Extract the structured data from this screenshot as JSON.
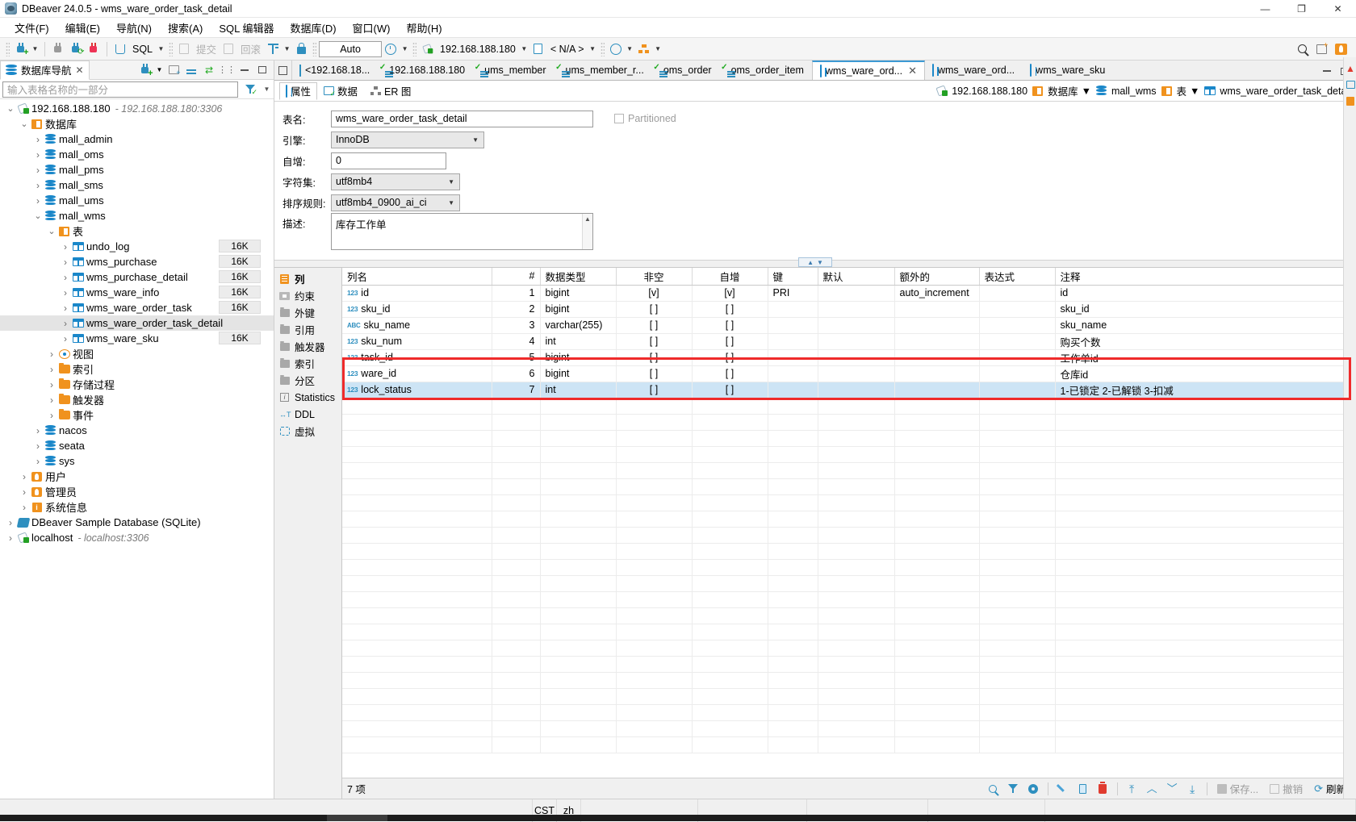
{
  "window": {
    "title": "DBeaver 24.0.5 - wms_ware_order_task_detail",
    "minimize": "—",
    "maximize": "❐",
    "close": "✕"
  },
  "menu": [
    {
      "label": "文件(F)"
    },
    {
      "label": "编辑(E)"
    },
    {
      "label": "导航(N)"
    },
    {
      "label": "搜索(A)"
    },
    {
      "label": "SQL 编辑器"
    },
    {
      "label": "数据库(D)"
    },
    {
      "label": "窗口(W)"
    },
    {
      "label": "帮助(H)"
    }
  ],
  "toolbar": {
    "sql_label": "SQL",
    "commit_label": "提交",
    "rollback_label": "回滚",
    "auto_label": "Auto",
    "connection": "192.168.188.180",
    "schema": "< N/A >"
  },
  "navigator": {
    "tab_label": "数据库导航",
    "tab_close": "✕",
    "filter_placeholder": "输入表格名称的一部分",
    "tree": [
      {
        "level": 0,
        "twisty": "v",
        "icon": "connection-icon",
        "label": "192.168.188.180",
        "sub": "- 192.168.188.180:3306"
      },
      {
        "level": 1,
        "twisty": "v",
        "icon": "databases-folder-icon",
        "label": "数据库"
      },
      {
        "level": 2,
        "twisty": ">",
        "icon": "database-icon",
        "label": "mall_admin"
      },
      {
        "level": 2,
        "twisty": ">",
        "icon": "database-icon",
        "label": "mall_oms"
      },
      {
        "level": 2,
        "twisty": ">",
        "icon": "database-icon",
        "label": "mall_pms"
      },
      {
        "level": 2,
        "twisty": ">",
        "icon": "database-icon",
        "label": "mall_sms"
      },
      {
        "level": 2,
        "twisty": ">",
        "icon": "database-icon",
        "label": "mall_ums"
      },
      {
        "level": 2,
        "twisty": "v",
        "icon": "database-icon",
        "label": "mall_wms"
      },
      {
        "level": 3,
        "twisty": "v",
        "icon": "tables-folder-icon",
        "label": "表"
      },
      {
        "level": 4,
        "twisty": ">",
        "icon": "table-icon",
        "label": "undo_log",
        "size": "16K"
      },
      {
        "level": 4,
        "twisty": ">",
        "icon": "table-icon",
        "label": "wms_purchase",
        "size": "16K"
      },
      {
        "level": 4,
        "twisty": ">",
        "icon": "table-icon",
        "label": "wms_purchase_detail",
        "size": "16K"
      },
      {
        "level": 4,
        "twisty": ">",
        "icon": "table-icon",
        "label": "wms_ware_info",
        "size": "16K"
      },
      {
        "level": 4,
        "twisty": ">",
        "icon": "table-icon",
        "label": "wms_ware_order_task",
        "size": "16K"
      },
      {
        "level": 4,
        "twisty": ">",
        "icon": "table-icon",
        "label": "wms_ware_order_task_detail",
        "size": "",
        "selected": true
      },
      {
        "level": 4,
        "twisty": ">",
        "icon": "table-icon",
        "label": "wms_ware_sku",
        "size": "16K"
      },
      {
        "level": 3,
        "twisty": ">",
        "icon": "view-icon",
        "label": "视图"
      },
      {
        "level": 3,
        "twisty": ">",
        "icon": "folder-icon",
        "label": "索引"
      },
      {
        "level": 3,
        "twisty": ">",
        "icon": "folder-icon",
        "label": "存储过程"
      },
      {
        "level": 3,
        "twisty": ">",
        "icon": "folder-icon",
        "label": "触发器"
      },
      {
        "level": 3,
        "twisty": ">",
        "icon": "folder-icon",
        "label": "事件"
      },
      {
        "level": 2,
        "twisty": ">",
        "icon": "database-icon",
        "label": "nacos"
      },
      {
        "level": 2,
        "twisty": ">",
        "icon": "database-icon",
        "label": "seata"
      },
      {
        "level": 2,
        "twisty": ">",
        "icon": "database-icon",
        "label": "sys"
      },
      {
        "level": 1,
        "twisty": ">",
        "icon": "users-icon",
        "label": "用户"
      },
      {
        "level": 1,
        "twisty": ">",
        "icon": "admin-icon",
        "label": "管理员"
      },
      {
        "level": 1,
        "twisty": ">",
        "icon": "sysinfo-icon",
        "label": "系统信息"
      },
      {
        "level": 0,
        "twisty": ">",
        "icon": "sqlite-icon",
        "label": "DBeaver Sample Database (SQLite)"
      },
      {
        "level": 0,
        "twisty": ">",
        "icon": "connection-icon",
        "label": "localhost",
        "sub": "- localhost:3306"
      }
    ]
  },
  "editor_tabs": [
    {
      "label": "<192.168.18...",
      "icon": "sql-editor-icon",
      "active": false
    },
    {
      "label": "192.168.188.180",
      "icon": "script-icon",
      "active": false
    },
    {
      "label": "ums_member",
      "icon": "script-icon",
      "active": false
    },
    {
      "label": "ums_member_r...",
      "icon": "script-icon",
      "active": false
    },
    {
      "label": "oms_order",
      "icon": "script-icon",
      "active": false
    },
    {
      "label": "oms_order_item",
      "icon": "script-icon",
      "active": false
    },
    {
      "label": "wms_ware_ord...",
      "icon": "table-icon",
      "active": true,
      "close": "✕"
    },
    {
      "label": "wms_ware_ord...",
      "icon": "table-icon",
      "active": false
    },
    {
      "label": "wms_ware_sku",
      "icon": "table-icon",
      "active": false
    }
  ],
  "property_tabs": [
    {
      "label": "属性",
      "icon": "properties-icon",
      "active": true
    },
    {
      "label": "数据",
      "icon": "data-icon",
      "active": false
    },
    {
      "label": "ER 图",
      "icon": "er-diagram-icon",
      "active": false
    }
  ],
  "breadcrumb": [
    {
      "label": "192.168.188.180",
      "icon": "connection-icon",
      "caret": false
    },
    {
      "label": "数据库",
      "icon": "databases-folder-icon",
      "caret": true
    },
    {
      "label": "mall_wms",
      "icon": "database-icon",
      "caret": false
    },
    {
      "label": "表",
      "icon": "tables-folder-icon",
      "caret": true
    },
    {
      "label": "wms_ware_order_task_detail",
      "icon": "table-icon",
      "caret": false
    }
  ],
  "form": {
    "table_name_label": "表名:",
    "table_name_value": "wms_ware_order_task_detail",
    "partitioned_label": "Partitioned",
    "engine_label": "引擎:",
    "engine_value": "InnoDB",
    "auto_increment_label": "自增:",
    "auto_increment_value": "0",
    "charset_label": "字符集:",
    "charset_value": "utf8mb4",
    "collation_label": "排序规则:",
    "collation_value": "utf8mb4_0900_ai_ci",
    "description_label": "描述:",
    "description_value": "库存工作单"
  },
  "side_tabs": [
    {
      "label": "列",
      "icon": "columns-icon",
      "active": true
    },
    {
      "label": "约束",
      "icon": "constraints-icon",
      "active": false
    },
    {
      "label": "外键",
      "icon": "foreign-keys-icon",
      "active": false
    },
    {
      "label": "引用",
      "icon": "references-icon",
      "active": false
    },
    {
      "label": "触发器",
      "icon": "triggers-icon",
      "active": false
    },
    {
      "label": "索引",
      "icon": "indexes-icon",
      "active": false
    },
    {
      "label": "分区",
      "icon": "partitions-icon",
      "active": false
    },
    {
      "label": "Statistics",
      "icon": "statistics-icon",
      "active": false
    },
    {
      "label": "DDL",
      "icon": "ddl-icon",
      "active": false
    },
    {
      "label": "虚拟",
      "icon": "virtual-icon",
      "active": false
    }
  ],
  "grid": {
    "columns": [
      {
        "key": "name",
        "label": "列名",
        "align": "left"
      },
      {
        "key": "num",
        "label": "#",
        "align": "right"
      },
      {
        "key": "type",
        "label": "数据类型",
        "align": "left"
      },
      {
        "key": "notnull",
        "label": "非空",
        "align": "center"
      },
      {
        "key": "autoinc",
        "label": "自增",
        "align": "center"
      },
      {
        "key": "key",
        "label": "键",
        "align": "left"
      },
      {
        "key": "default",
        "label": "默认",
        "align": "left"
      },
      {
        "key": "extra",
        "label": "额外的",
        "align": "left"
      },
      {
        "key": "expression",
        "label": "表达式",
        "align": "left"
      },
      {
        "key": "comment",
        "label": "注释",
        "align": "left"
      }
    ],
    "rows": [
      {
        "icon": "123",
        "name": "id",
        "num": "1",
        "type": "bigint",
        "notnull": "[v]",
        "autoinc": "[v]",
        "key": "PRI",
        "default": "",
        "extra": "auto_increment",
        "expression": "",
        "comment": "id",
        "selected": false
      },
      {
        "icon": "123",
        "name": "sku_id",
        "num": "2",
        "type": "bigint",
        "notnull": "[ ]",
        "autoinc": "[ ]",
        "key": "",
        "default": "",
        "extra": "",
        "expression": "",
        "comment": "sku_id",
        "selected": false
      },
      {
        "icon": "ABC",
        "name": "sku_name",
        "num": "3",
        "type": "varchar(255)",
        "notnull": "[ ]",
        "autoinc": "[ ]",
        "key": "",
        "default": "",
        "extra": "",
        "expression": "",
        "comment": "sku_name",
        "selected": false
      },
      {
        "icon": "123",
        "name": "sku_num",
        "num": "4",
        "type": "int",
        "notnull": "[ ]",
        "autoinc": "[ ]",
        "key": "",
        "default": "",
        "extra": "",
        "expression": "",
        "comment": "购买个数",
        "selected": false
      },
      {
        "icon": "123",
        "name": "task_id",
        "num": "5",
        "type": "bigint",
        "notnull": "[ ]",
        "autoinc": "[ ]",
        "key": "",
        "default": "",
        "extra": "",
        "expression": "",
        "comment": "工作单id",
        "selected": false
      },
      {
        "icon": "123",
        "name": "ware_id",
        "num": "6",
        "type": "bigint",
        "notnull": "[ ]",
        "autoinc": "[ ]",
        "key": "",
        "default": "",
        "extra": "",
        "expression": "",
        "comment": "仓库id",
        "selected": false
      },
      {
        "icon": "123",
        "name": "lock_status",
        "num": "7",
        "type": "int",
        "notnull": "[ ]",
        "autoinc": "[ ]",
        "key": "",
        "default": "",
        "extra": "",
        "expression": "",
        "comment": "1-已锁定 2-已解锁 3-扣减",
        "selected": true
      }
    ],
    "count_label": "7 项",
    "toolbar": {
      "save_label": "保存...",
      "revert_label": "撤销",
      "refresh_label": "刷新"
    }
  },
  "status": {
    "encoding": "CST",
    "language": "zh"
  },
  "colors": {
    "accent": "#2e8fbf",
    "selection": "#cde4f5",
    "annotation": "#ef2b2b",
    "folder": "#f0921e"
  }
}
